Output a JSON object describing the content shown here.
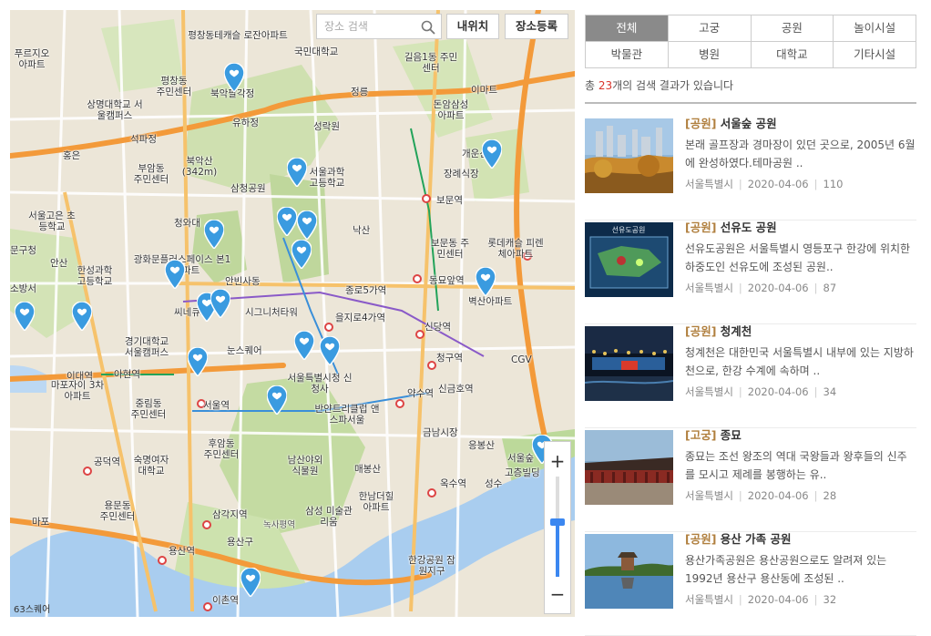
{
  "map": {
    "search_placeholder": "장소 검색",
    "my_location_label": "내위치",
    "register_label": "장소등록",
    "zoom_in": "+",
    "zoom_out": "−",
    "zoom_level_fraction": 0.55,
    "attribution": "63스퀘어",
    "labels": [
      "평창동테캐슬 로잔아파트",
      "국민대학교",
      "길음1동 주민센터",
      "푸르지오 아파트",
      "북악팔각정",
      "평창동 주민센터",
      "정릉",
      "이마트",
      "돈암삼성 아파트",
      "상명대학교 서울캠퍼스",
      "유하정",
      "성락원",
      "석파정",
      "홍은",
      "부암동 주민센터",
      "북악산 (342m)",
      "서울과학 고등학교",
      "삼청공원",
      "개운산",
      "장례식장",
      "보문역",
      "서울고은 초등학교",
      "청와대",
      "낙산",
      "보문동 주민센터",
      "롯데캐슬 피렌체아파트",
      "문구청",
      "안산",
      "광화문플러스페이스 본1동아파트",
      "한성과학 고등학교",
      "안빈사동",
      "동묘앞역",
      "소방서",
      "종로5가역",
      "벽산아파트",
      "씨네큐브",
      "시그니처타워",
      "을지로4가역",
      "신당역",
      "경기대학교 서울캠퍼스",
      "눈스퀘어",
      "청구역",
      "CGV",
      "이대역",
      "아현역",
      "마포자이 3차아파트",
      "중림동 주민센터",
      "서울역",
      "서울특별시청 신청사",
      "반얀트리클럽 앤스파서울",
      "약수역",
      "신금호역",
      "금남시장",
      "응봉산",
      "후암동 주민센터",
      "숙명여자 대학교",
      "남산야외 식물원",
      "매봉산",
      "공덕역",
      "옥수역",
      "성수",
      "용문동 주민센터",
      "한남더힐 아파트",
      "마포",
      "삼각지역",
      "녹사평역",
      "삼성 미술관리움",
      "서울숲",
      "용산역",
      "용산구",
      "한강공원 잠원지구",
      "이촌역",
      "고층빌딩"
    ]
  },
  "filters": [
    "전체",
    "고궁",
    "공원",
    "놀이시설",
    "박물관",
    "병원",
    "대학교",
    "기타시설"
  ],
  "active_filter": "전체",
  "result": {
    "prefix": "총 ",
    "count": "23",
    "suffix": "개의 검색 결과가 있습니다"
  },
  "items": [
    {
      "category": "[공원]",
      "name": "서울숲 공원",
      "desc": "본래 골프장과 경마장이 있던 곳으로, 2005년 6월에 완성하였다.테마공원 ..",
      "region": "서울특별시",
      "date": "2020-04-06",
      "views": "110"
    },
    {
      "category": "[공원]",
      "name": "선유도 공원",
      "desc": "선유도공원은 서울특별시 영등포구 한강에 위치한 하중도인 선유도에 조성된 공원..",
      "region": "서울특별시",
      "date": "2020-04-06",
      "views": "87"
    },
    {
      "category": "[공원]",
      "name": "청계천",
      "desc": "청계천은 대한민국 서울특별시 내부에 있는 지방하천으로, 한강 수계에 속하며 ..",
      "region": "서울특별시",
      "date": "2020-04-06",
      "views": "34"
    },
    {
      "category": "[고궁]",
      "name": "종묘",
      "desc": "종묘는 조선 왕조의 역대 국왕들과 왕후들의 신주를 모시고 제례를 봉행하는 유..",
      "region": "서울특별시",
      "date": "2020-04-06",
      "views": "28"
    },
    {
      "category": "[공원]",
      "name": "용산 가족 공원",
      "desc": "용산가족공원은 용산공원으로도 알려져 있는 1992년 용산구 용산동에 조성된 ..",
      "region": "서울특별시",
      "date": "2020-04-06",
      "views": "32"
    }
  ],
  "thumb_captions": [
    "선유도공원"
  ],
  "colors": {
    "marker": "#3a9be0",
    "road_major": "#f39a3a",
    "river": "#a9cdef",
    "park": "#bfd79c",
    "active_filter": "#8a8a8a",
    "count": "#d9342b"
  }
}
